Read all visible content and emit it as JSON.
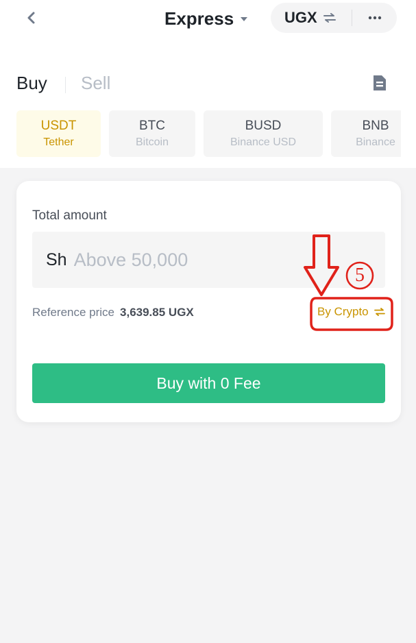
{
  "header": {
    "title": "Express",
    "currency": "UGX",
    "icons": {
      "back": "chevron-left-icon",
      "title_caret": "caret-down-icon",
      "swap": "swap-icon",
      "more": "more-icon"
    }
  },
  "tabs": [
    {
      "label": "Buy",
      "active": true
    },
    {
      "label": "Sell",
      "active": false
    }
  ],
  "order_icon": "document-icon",
  "cryptos": [
    {
      "symbol": "USDT",
      "name": "Tether",
      "selected": true
    },
    {
      "symbol": "BTC",
      "name": "Bitcoin",
      "selected": false
    },
    {
      "symbol": "BUSD",
      "name": "Binance USD",
      "selected": false
    },
    {
      "symbol": "BNB",
      "name": "Binance",
      "selected": false
    }
  ],
  "form": {
    "label": "Total amount",
    "currency_prefix": "Sh",
    "amount_value": "",
    "amount_placeholder": "Above 50,000",
    "reference_label": "Reference price",
    "reference_value": "3,639.85 UGX",
    "toggle_label": "By Crypto",
    "submit_label": "Buy with 0 Fee"
  },
  "annotation": {
    "step_number": "5",
    "color": "#e0221a"
  },
  "colors": {
    "accent": "#c99400",
    "accent_bg": "#fefbe8",
    "primary_button": "#2ebd85",
    "text_primary": "#1e2329",
    "text_muted": "#b7bdc6"
  }
}
